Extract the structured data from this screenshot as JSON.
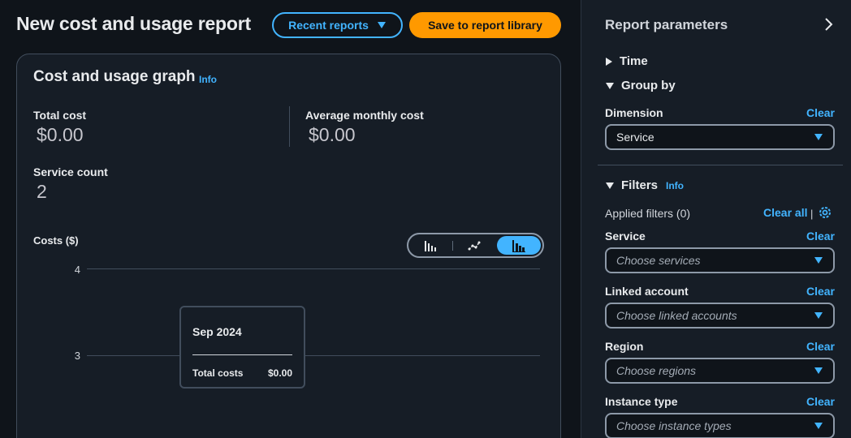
{
  "header": {
    "title": "New cost and usage report",
    "recent_reports_label": "Recent reports",
    "save_label": "Save to report library"
  },
  "graph": {
    "title": "Cost and usage graph",
    "info_label": "Info",
    "total_cost_label": "Total cost",
    "total_cost_value": "$0.00",
    "avg_monthly_label": "Average monthly cost",
    "avg_monthly_value": "$0.00",
    "service_count_label": "Service count",
    "service_count_value": "2",
    "costs_axis_label": "Costs ($)",
    "chart_type_icons": [
      "bar-chart-icon",
      "line-chart-icon",
      "stacked-bar-chart-icon"
    ],
    "active_chart_type": "stacked-bar-chart-icon",
    "y_ticks": [
      "4",
      "3"
    ],
    "tooltip": {
      "title": "Sep 2024",
      "row_label": "Total costs",
      "row_value": "$0.00"
    }
  },
  "panel": {
    "title": "Report parameters",
    "time_label": "Time",
    "group_by_label": "Group by",
    "dimension_label": "Dimension",
    "dimension_value": "Service",
    "clear_label": "Clear",
    "filters_label": "Filters",
    "filters_info": "Info",
    "applied_filters": "Applied filters (0)",
    "clear_all_label": "Clear all",
    "service_label": "Service",
    "service_placeholder": "Choose services",
    "linked_account_label": "Linked account",
    "linked_account_placeholder": "Choose linked accounts",
    "region_label": "Region",
    "region_placeholder": "Choose regions",
    "instance_type_label": "Instance type",
    "instance_type_placeholder": "Choose instance types"
  },
  "colors": {
    "accent": "#42b4ff",
    "primary_button": "#ff9900",
    "background": "#0f141a",
    "surface": "#161d26"
  }
}
